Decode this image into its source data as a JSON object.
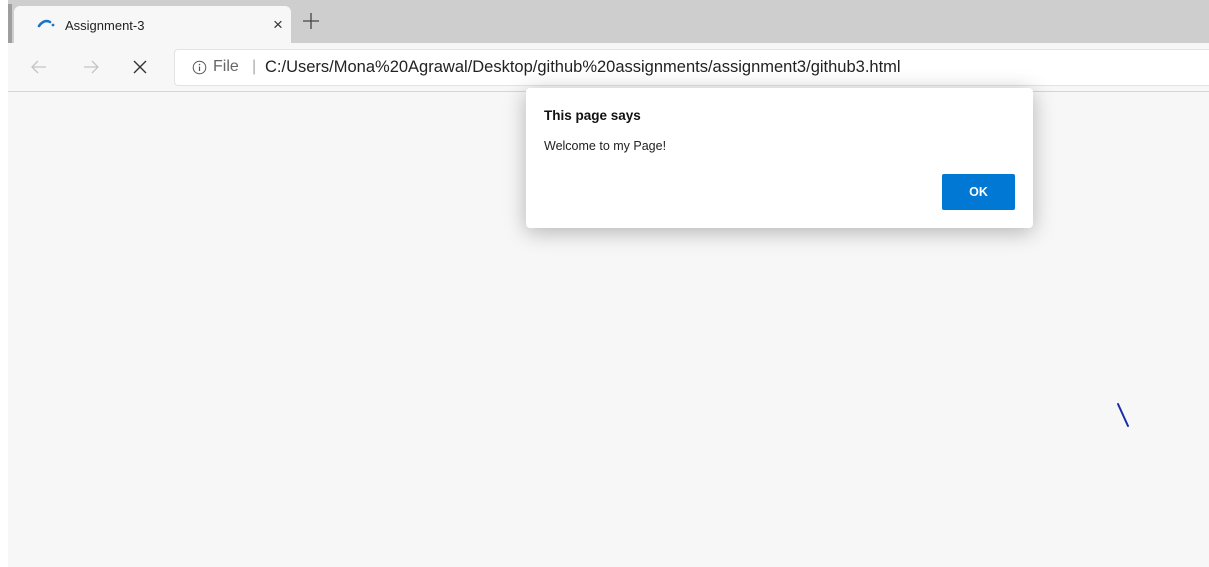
{
  "tab": {
    "title": "Assignment-3",
    "close_glyph": "×",
    "loading_icon": "loading-spinner-icon",
    "new_tab_icon": "plus-icon"
  },
  "toolbar": {
    "back_icon": "arrow-left-icon",
    "forward_icon": "arrow-right-icon",
    "stop_icon": "close-icon"
  },
  "address_bar": {
    "info_icon": "info-icon",
    "scheme_label": "File",
    "separator": "|",
    "url": "C:/Users/Mona%20Agrawal/Desktop/github%20assignments/assignment3/github3.html"
  },
  "dialog": {
    "title": "This page says",
    "message": "Welcome to my Page!",
    "ok_label": "OK"
  },
  "colors": {
    "accent": "#0078d4",
    "tab_strip": "#cecece",
    "toolbar": "#f7f7f7",
    "page_background": "#f7f7f7",
    "spinner": "#1a73c8",
    "cursor_mark": "#1c2ca8"
  }
}
